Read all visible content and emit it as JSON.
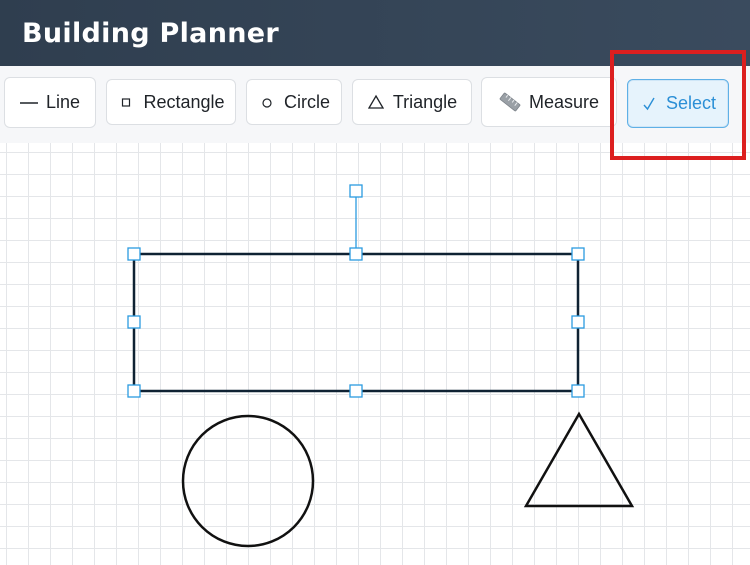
{
  "app": {
    "title": "Building Planner"
  },
  "toolbar": {
    "tools": [
      {
        "id": "line",
        "label": "Line",
        "icon": "line-icon",
        "active": false
      },
      {
        "id": "rectangle",
        "label": "Rectangle",
        "icon": "rectangle-icon",
        "active": false
      },
      {
        "id": "circle",
        "label": "Circle",
        "icon": "circle-icon",
        "active": false
      },
      {
        "id": "triangle",
        "label": "Triangle",
        "icon": "triangle-icon",
        "active": false
      },
      {
        "id": "measure",
        "label": "Measure",
        "icon": "ruler-icon",
        "active": false
      },
      {
        "id": "select",
        "label": "Select",
        "icon": "checkmark-icon",
        "active": true
      }
    ]
  },
  "canvas": {
    "shapes": [
      {
        "type": "rectangle",
        "selected": true
      },
      {
        "type": "circle",
        "selected": false
      },
      {
        "type": "triangle",
        "selected": false
      }
    ]
  },
  "colors": {
    "header_bg": "#34455a",
    "active_tool_bg": "#e6f3fc",
    "active_tool_text": "#2b8fd6",
    "selection_handle": "#2b9be0",
    "highlight": "#dc1f1f",
    "shape_stroke": "#111111"
  }
}
